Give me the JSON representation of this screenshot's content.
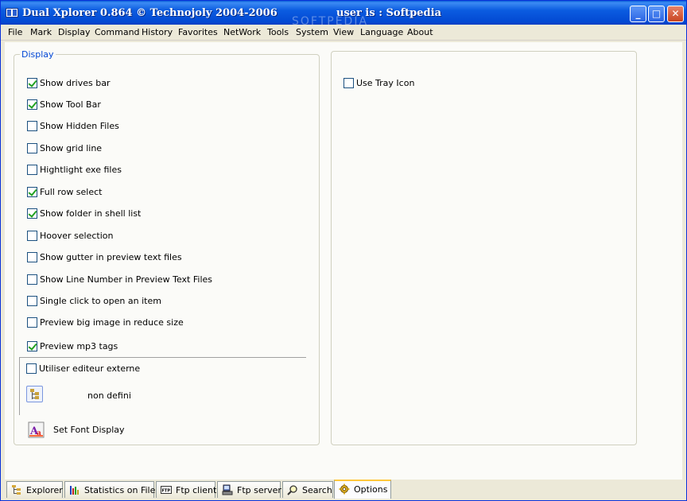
{
  "window": {
    "title": "Dual Xplorer 0.864  © Technojoly 2004-2006",
    "user": "user is :  Softpedia",
    "watermark": "SOFTPEDIA",
    "controls": {
      "minimize": "_",
      "maximize": "□",
      "close": "✕"
    }
  },
  "menu": [
    "File",
    "Mark",
    "Display",
    "Command",
    "History",
    "Favorites",
    "NetWork",
    "Tools",
    "System",
    "View",
    "Language",
    "About"
  ],
  "display_group": {
    "caption": "Display",
    "options": [
      {
        "label": "Show drives bar",
        "checked": true
      },
      {
        "label": "Show Tool Bar",
        "checked": true
      },
      {
        "label": "Show Hidden Files",
        "checked": false
      },
      {
        "label": "Show grid line",
        "checked": false
      },
      {
        "label": "Hightlight exe files",
        "checked": false
      },
      {
        "label": "Full row select",
        "checked": true
      },
      {
        "label": "Show folder in shell list",
        "checked": true
      },
      {
        "label": "Hoover selection",
        "checked": false
      },
      {
        "label": "Show gutter in preview text files",
        "checked": false
      },
      {
        "label": "Show Line Number in Preview Text Files",
        "checked": false
      },
      {
        "label": "Single click to open an item",
        "checked": false
      },
      {
        "label": "Preview big image in reduce size",
        "checked": false
      },
      {
        "label": "Preview mp3 tags",
        "checked": true
      }
    ],
    "external_editor": {
      "label": "Utiliser editeur externe",
      "checked": false
    },
    "editor_path": "non defini",
    "font_button_label": "Set Font Display"
  },
  "right_group": {
    "options": [
      {
        "label": "Use Tray Icon",
        "checked": false
      }
    ]
  },
  "tabs": [
    {
      "label": "Explorer",
      "icon": "tree-icon",
      "active": false
    },
    {
      "label": "Statistics on Files",
      "icon": "bar-chart-icon",
      "active": false
    },
    {
      "label": "Ftp client",
      "icon": "ftp-icon",
      "active": false
    },
    {
      "label": "Ftp server",
      "icon": "server-icon",
      "active": false
    },
    {
      "label": "Search",
      "icon": "search-icon",
      "active": false
    },
    {
      "label": "Options",
      "icon": "gear-icon",
      "active": true
    }
  ],
  "colors": {
    "titlebar": "#0b5ce0",
    "caption": "#0046d5",
    "check": "#21a121",
    "active_tab_top": "#ffc83c"
  }
}
